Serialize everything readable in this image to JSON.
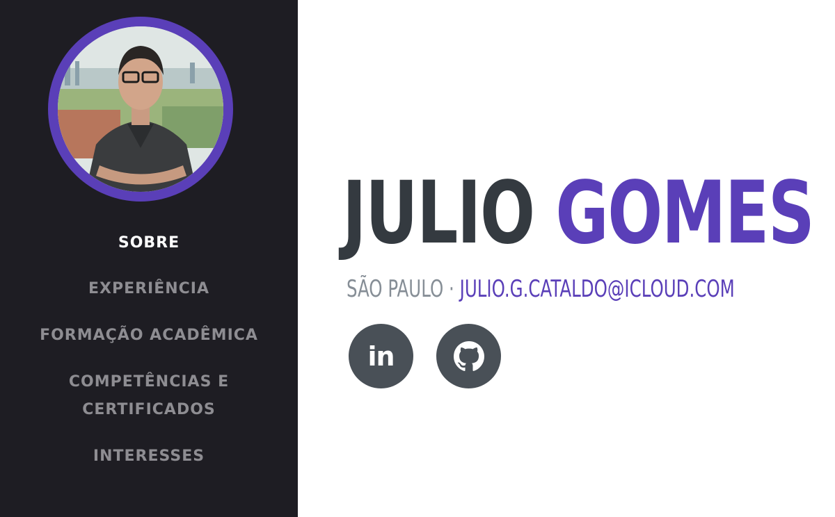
{
  "profile": {
    "first_name": "JULIO",
    "last_name": "GOMES",
    "location": "SÃO PAULO",
    "separator": " · ",
    "email": "JULIO.G.CATALDO@ICLOUD.COM"
  },
  "nav": {
    "items": [
      {
        "label": "SOBRE",
        "active": true
      },
      {
        "label": "EXPERIÊNCIA",
        "active": false
      },
      {
        "label": "FORMAÇÃO ACADÊMICA",
        "active": false
      },
      {
        "label_line1": "COMPETÊNCIAS E",
        "label_line2": "CERTIFICADOS",
        "active": false
      },
      {
        "label": "INTERESSES",
        "active": false
      }
    ]
  },
  "social": {
    "linkedin_icon": "linkedin-icon",
    "linkedin_glyph": "in",
    "github_icon": "github-icon"
  },
  "colors": {
    "sidebar_bg": "#1e1d23",
    "accent": "#5a3fb8",
    "heading_dark": "#343a40",
    "muted": "#868e96",
    "social_bg": "#495057"
  }
}
